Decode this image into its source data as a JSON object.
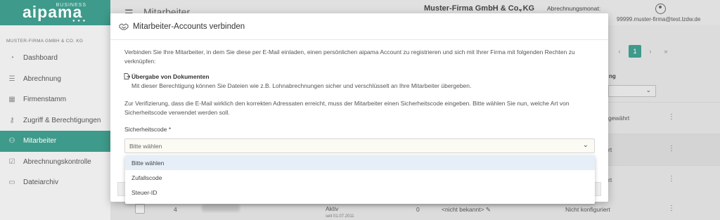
{
  "app": {
    "logo_badge": "BUSINESS",
    "logo_text": "aipama",
    "brand_color": "#3e9a8b"
  },
  "sidebar": {
    "company": "MUSTER-FIRMA GMBH & CO. KG",
    "items": [
      {
        "label": "Dashboard",
        "icon": "speedometer-icon",
        "active": false
      },
      {
        "label": "Abrechnung",
        "icon": "list-icon",
        "active": false
      },
      {
        "label": "Firmenstamm",
        "icon": "building-icon",
        "active": false
      },
      {
        "label": "Zugriff & Berechtigungen",
        "icon": "key-icon",
        "active": false
      },
      {
        "label": "Mitarbeiter",
        "icon": "people-icon",
        "active": true
      },
      {
        "label": "Abrechnungskontrolle",
        "icon": "clipboard-check-icon",
        "active": false
      },
      {
        "label": "Dateiarchiv",
        "icon": "archive-icon",
        "active": false
      }
    ]
  },
  "header": {
    "page_title": "Mitarbeiter",
    "firm_name": "Muster-Firma GmbH & Co. KG",
    "month_label": "Abrechnungsmonat:",
    "user_email": "99999.muster-firma@test.lzdw.de"
  },
  "background": {
    "pager": {
      "prev": "‹",
      "current": "1",
      "next": "›",
      "last": "»"
    },
    "column_heading": "ng",
    "rows": [
      {
        "right_text": "gewährt"
      },
      {
        "right_text": "rt"
      },
      {
        "right_text": "rt"
      }
    ],
    "row4": {
      "number": "4",
      "status": "Aktiv",
      "since": "seit 01.07.2011",
      "count": "0",
      "unknown": "<nicht bekannt>",
      "config": "Nicht konfiguriert"
    }
  },
  "modal": {
    "title": "Mitarbeiter-Accounts verbinden",
    "intro": "Verbinden Sie Ihre Mitarbeiter, in dem Sie diese per E-Mail einladen, einen persönlichen aipama Account zu registrieren und sich mit Ihrer Firma mit folgenden Rechten zu verknüpfen:",
    "permission_title": "Übergabe von Dokumenten",
    "permission_desc": "Mit dieser Berechtigung können Sie Dateien wie z.B. Lohnabrechnungen sicher und verschlüsselt an Ihre Mitarbeiter übergeben.",
    "verification_text": "Zur Verifizierung, dass die E-Mail wirklich den korrekten Adressaten erreicht, muss der Mitarbeiter einen Sicherheitscode eingeben. Bitte wählen Sie nun, welche Art von Sicherheitscode verwendet werden soll.",
    "field_label": "Sicherheitscode *",
    "select_value": "Bitte wählen",
    "options": [
      "Bitte wählen",
      "Zufallscode",
      "Steuer-ID"
    ]
  }
}
